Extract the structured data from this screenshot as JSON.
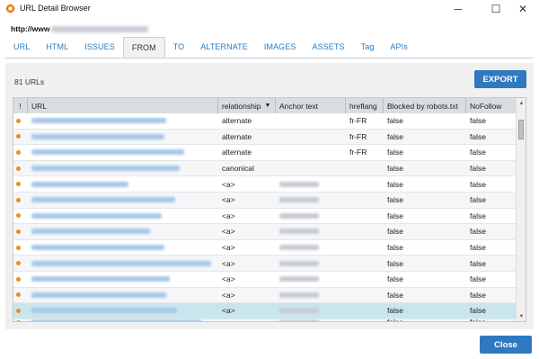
{
  "window": {
    "title": "URL Detail Browser",
    "minimize_glyph": "─",
    "maximize_glyph": "☐",
    "close_glyph": "✕",
    "app_icon": "gear-icon",
    "accent_color": "#f08a24"
  },
  "url_line": {
    "prefix": "http://www"
  },
  "tabs": [
    {
      "label": "URL"
    },
    {
      "label": "HTML"
    },
    {
      "label": "ISSUES"
    },
    {
      "label": "FROM"
    },
    {
      "label": "TO"
    },
    {
      "label": "ALTERNATE"
    },
    {
      "label": "IMAGES"
    },
    {
      "label": "ASSETS"
    },
    {
      "label": "Tag"
    },
    {
      "label": "APIs"
    }
  ],
  "active_tab": "FROM",
  "summary": {
    "count_text": "81 URLs"
  },
  "buttons": {
    "export": "EXPORT",
    "close": "Close",
    "button_color": "#2f79c0"
  },
  "table": {
    "columns": [
      {
        "label": "!"
      },
      {
        "label": "URL"
      },
      {
        "label": "relationship",
        "sort": "▼"
      },
      {
        "label": "Anchor text"
      },
      {
        "label": "hreflang"
      },
      {
        "label": "Blocked by robots.txt"
      },
      {
        "label": "NoFollow"
      }
    ],
    "rows": [
      {
        "relationship": "alternate",
        "hreflang": "fr-FR",
        "blocked": "false",
        "nofollow": "false"
      },
      {
        "relationship": "alternate",
        "hreflang": "fr-FR",
        "blocked": "false",
        "nofollow": "false"
      },
      {
        "relationship": "alternate",
        "hreflang": "fr-FR",
        "blocked": "false",
        "nofollow": "false"
      },
      {
        "relationship": "canonical",
        "hreflang": "",
        "blocked": "false",
        "nofollow": "false"
      },
      {
        "relationship": "<a>",
        "hreflang": "",
        "blocked": "false",
        "nofollow": "false"
      },
      {
        "relationship": "<a>",
        "hreflang": "",
        "blocked": "false",
        "nofollow": "false"
      },
      {
        "relationship": "<a>",
        "hreflang": "",
        "blocked": "false",
        "nofollow": "false"
      },
      {
        "relationship": "<a>",
        "hreflang": "",
        "blocked": "false",
        "nofollow": "false"
      },
      {
        "relationship": "<a>",
        "hreflang": "",
        "blocked": "false",
        "nofollow": "false"
      },
      {
        "relationship": "<a>",
        "hreflang": "",
        "blocked": "false",
        "nofollow": "false"
      },
      {
        "relationship": "<a>",
        "hreflang": "",
        "blocked": "false",
        "nofollow": "false"
      },
      {
        "relationship": "<a>",
        "hreflang": "",
        "blocked": "false",
        "nofollow": "false"
      },
      {
        "relationship": "<a>",
        "hreflang": "",
        "blocked": "false",
        "nofollow": "false"
      },
      {
        "relationship": "",
        "hreflang": "",
        "blocked": "false",
        "nofollow": "false"
      }
    ],
    "selected_row": 12
  }
}
